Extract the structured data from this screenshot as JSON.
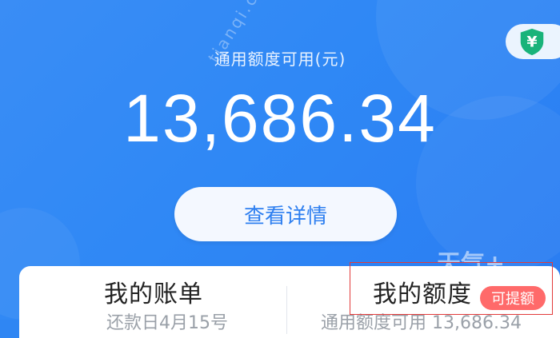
{
  "header": {
    "available_label": "通用额度可用(元)",
    "amount": "13,686.34",
    "details_button": "查看详情"
  },
  "badge": {
    "icon": "yen-shield-icon",
    "color": "#19b37a"
  },
  "watermark": {
    "text": "tianqi.com",
    "brand": "天气+"
  },
  "cards": {
    "bill": {
      "title": "我的账单",
      "subtitle": "还款日4月15号"
    },
    "quota": {
      "title": "我的额度",
      "subtitle": "通用额度可用 13,686.34",
      "tag": "可提额"
    }
  },
  "colors": {
    "primary": "#2f86f3",
    "accent_red": "#ff6a6a",
    "button_text": "#2e7ff0"
  }
}
